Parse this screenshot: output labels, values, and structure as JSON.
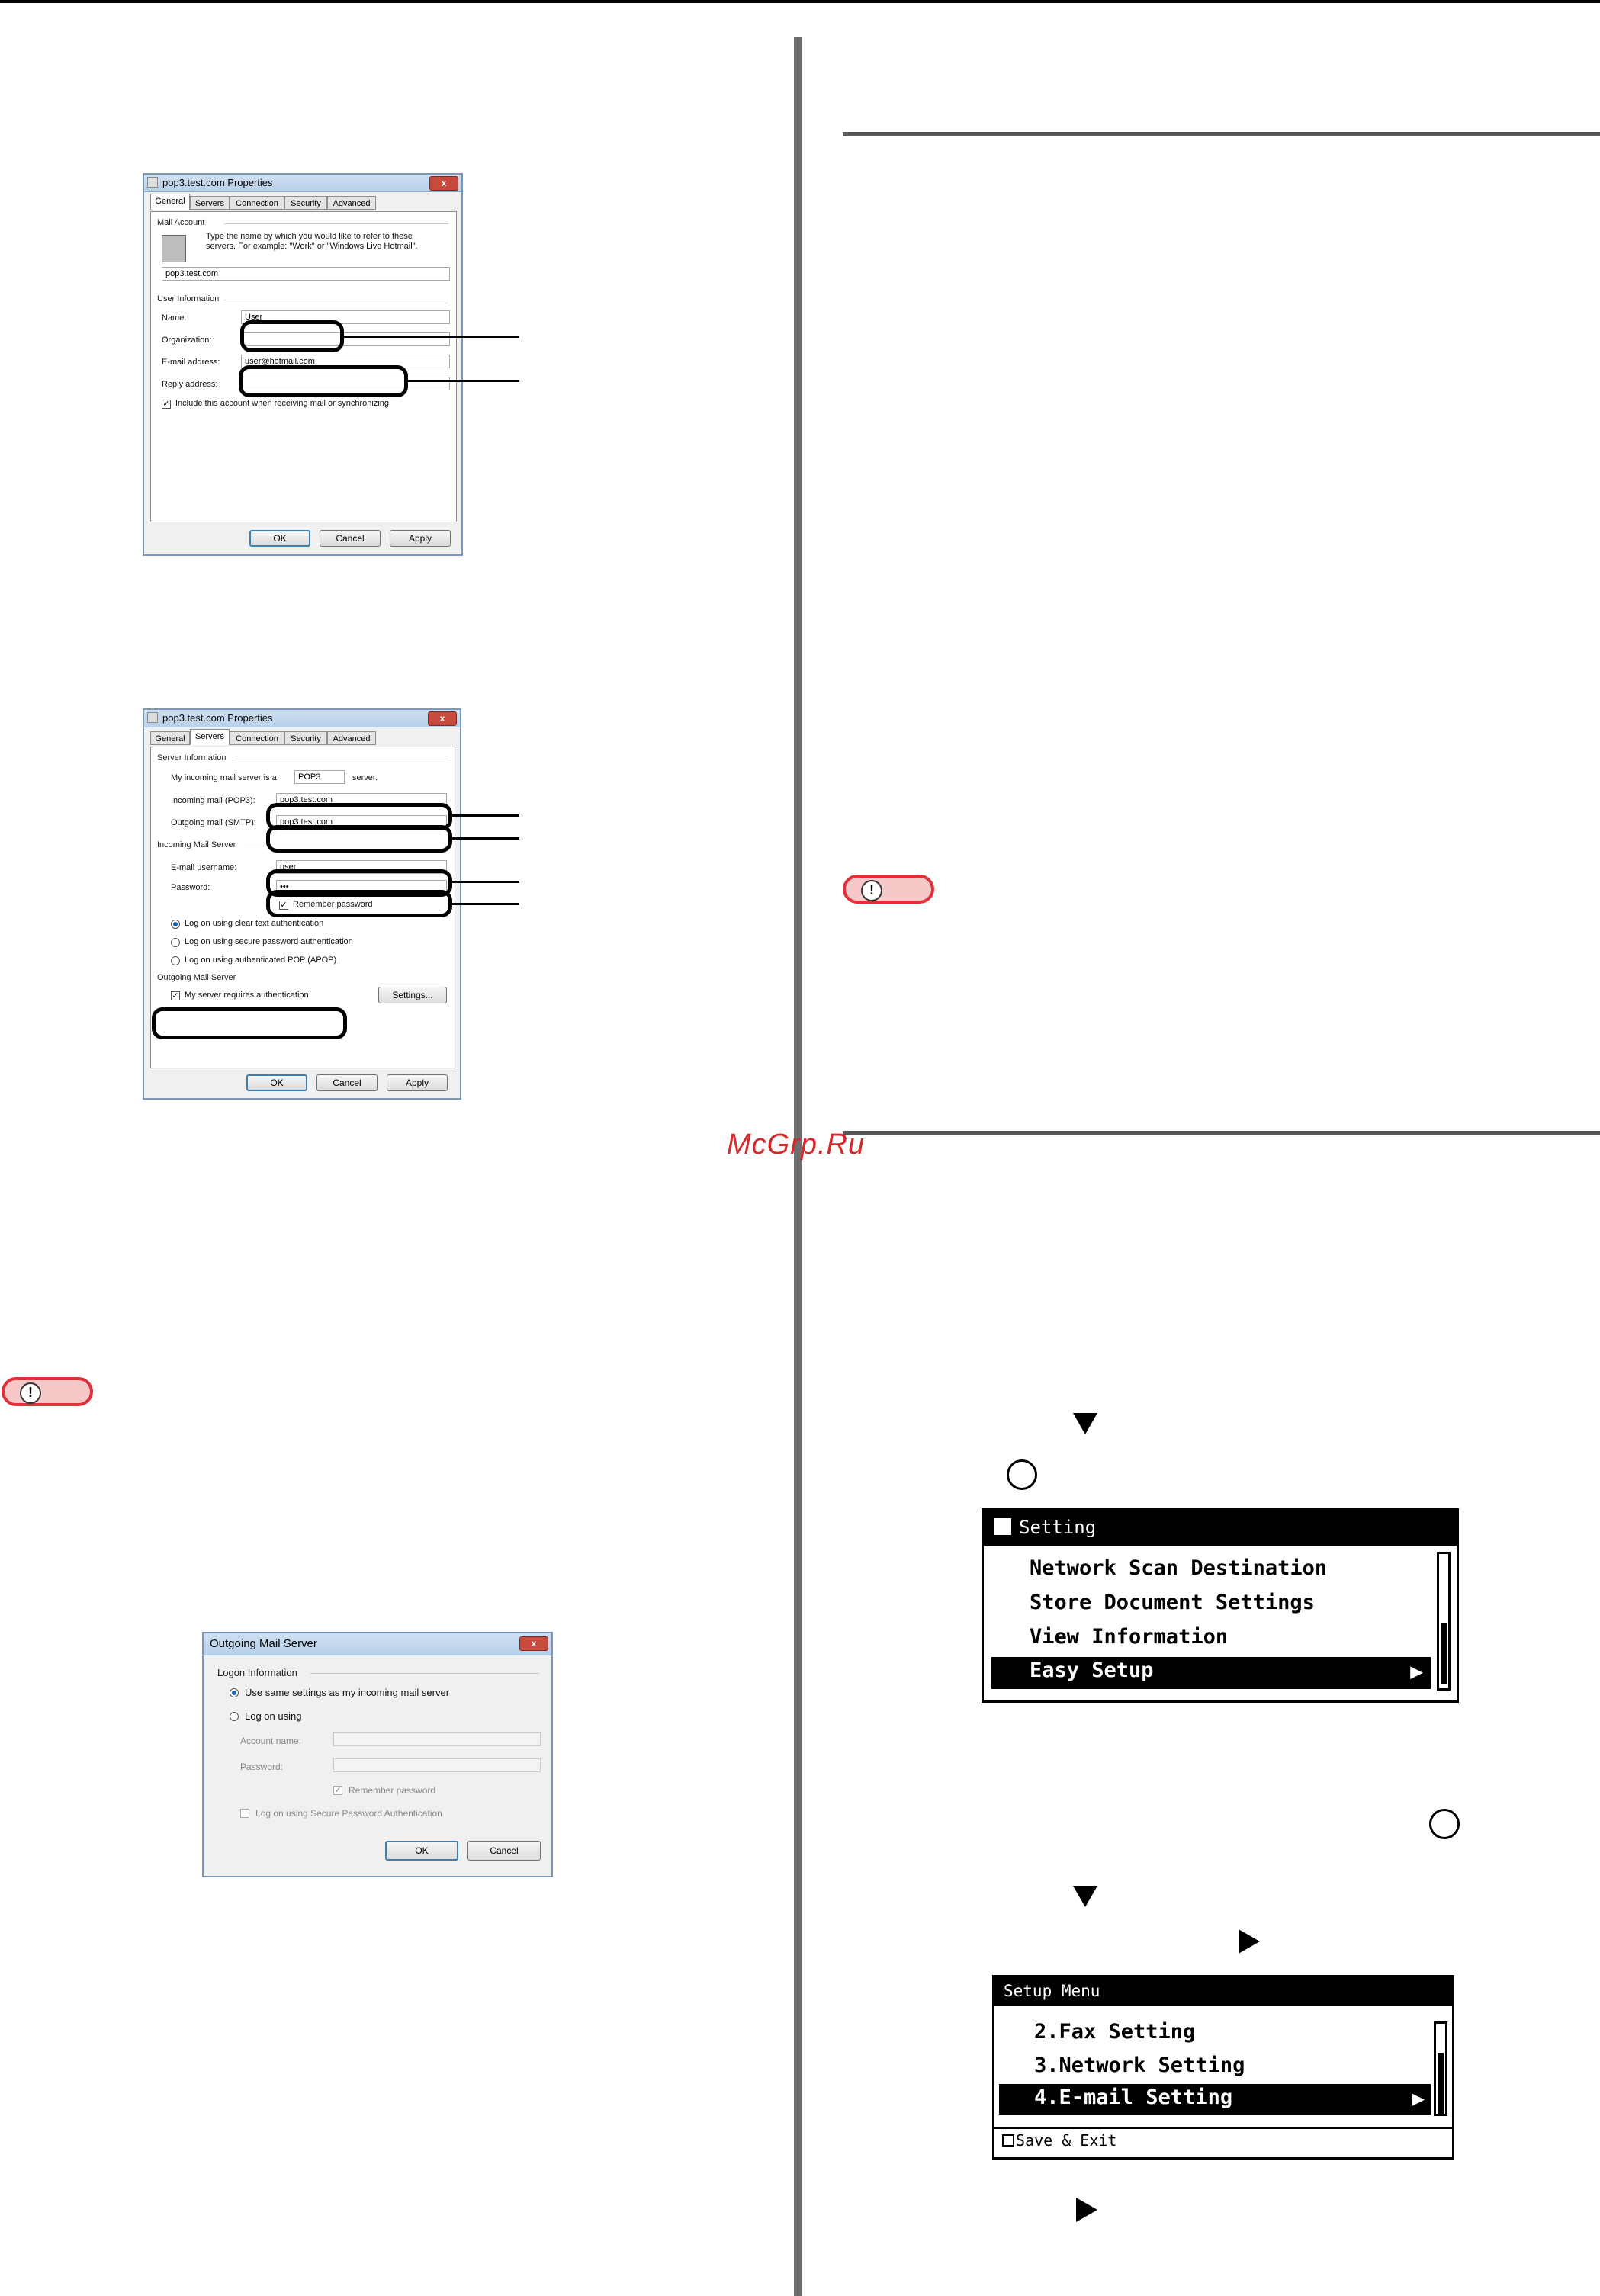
{
  "watermark": "McGrp.Ru",
  "dialog_general": {
    "title": "pop3.test.com Properties",
    "close": "x",
    "tabs": [
      "General",
      "Servers",
      "Connection",
      "Security",
      "Advanced"
    ],
    "mail_account_group": "Mail Account",
    "mail_account_desc": "Type the name by which you would like to refer to these servers.  For example: \"Work\" or \"Windows Live Hotmail\".",
    "account_name": "pop3.test.com",
    "user_info_group": "User Information",
    "name_label": "Name:",
    "name_value": "User",
    "org_label": "Organization:",
    "email_label": "E-mail address:",
    "email_value": "user@hotmail.com",
    "reply_label": "Reply address:",
    "include_label": "Include this account when receiving mail or synchronizing",
    "ok": "OK",
    "cancel": "Cancel",
    "apply": "Apply"
  },
  "dialog_servers": {
    "title": "pop3.test.com Properties",
    "close": "x",
    "tabs": [
      "General",
      "Servers",
      "Connection",
      "Security",
      "Advanced"
    ],
    "server_info_group": "Server Information",
    "incoming_is_label": "My incoming mail server is a",
    "server_type": "POP3",
    "server_suffix": "server.",
    "incoming_label": "Incoming mail (POP3):",
    "incoming_value": "pop3.test.com",
    "outgoing_label": "Outgoing mail (SMTP):",
    "outgoing_value": "pop3.test.com",
    "incoming_server_group": "Incoming Mail Server",
    "username_label": "E-mail username:",
    "username_value": "user",
    "password_label": "Password:",
    "password_value": "•••",
    "remember_label": "Remember password",
    "radio_clear": "Log on using clear text authentication",
    "radio_secure": "Log on using secure password authentication",
    "radio_apop": "Log on using authenticated POP (APOP)",
    "outgoing_group": "Outgoing Mail Server",
    "requires_auth_label": "My server requires authentication",
    "settings_button": "Settings...",
    "ok": "OK",
    "cancel": "Cancel",
    "apply": "Apply"
  },
  "dialog_outgoing": {
    "title": "Outgoing Mail Server",
    "close": "x",
    "logon_group": "Logon Information",
    "radio_same": "Use same settings as my incoming mail server",
    "radio_logon": "Log on using",
    "account_label": "Account name:",
    "password_label": "Password:",
    "remember_label": "Remember password",
    "spa_label": "Log on using Secure Password Authentication",
    "ok": "OK",
    "cancel": "Cancel"
  },
  "lcd_setting": {
    "header": "Setting",
    "items": [
      "Network Scan Destination",
      "Store Document Settings",
      "View Information"
    ],
    "selected": "Easy Setup",
    "selected_arrow": "▶"
  },
  "lcd_setup": {
    "header": "Setup Menu",
    "items": [
      "2.Fax Setting",
      "3.Network Setting"
    ],
    "selected": "4.E-mail Setting",
    "selected_arrow": "▶",
    "footer": "Save & Exit"
  },
  "notes": {
    "bang": "!"
  }
}
